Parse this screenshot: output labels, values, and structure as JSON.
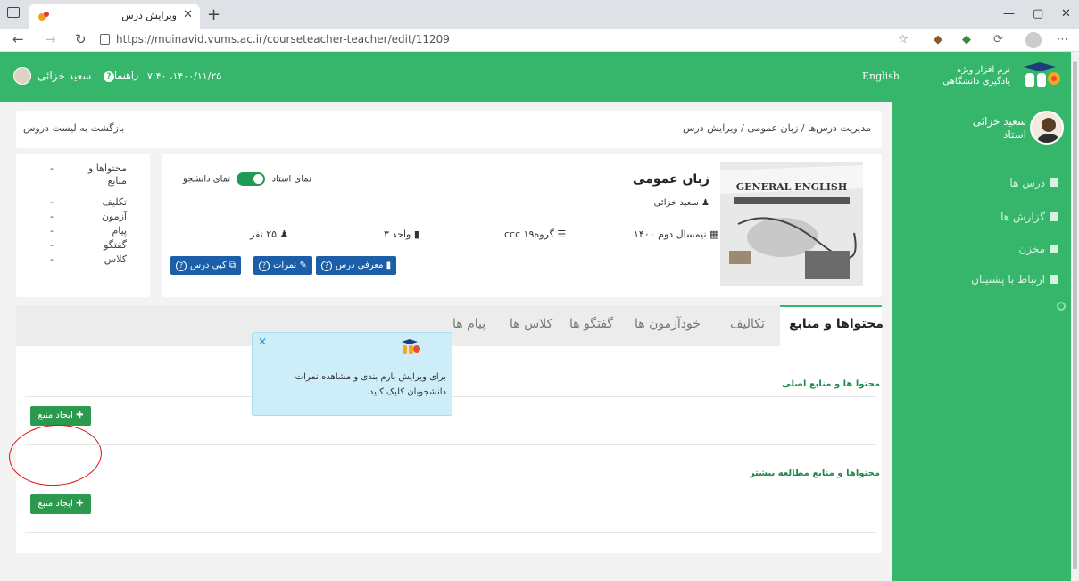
{
  "browser": {
    "tab_title": "ویرایش درس",
    "url": "https://muinavid.vums.ac.ir/courseteacher-teacher/edit/11209"
  },
  "header": {
    "brand_line1": "نرم افزار ویژه",
    "brand_line2": "یادگیری دانشگاهی",
    "language": "English",
    "user_name": "سعید خزائی",
    "help": "راهنما",
    "datetime": "۷:۴۰ ،۱۴۰۰/۱۱/۲۵"
  },
  "sidebar": {
    "user_name": "سعید خزائی",
    "user_role": "استاد",
    "items": [
      {
        "label": "درس ها",
        "icon": "book-icon"
      },
      {
        "label": "گزارش ها",
        "icon": "chart-icon"
      },
      {
        "label": "مخزن",
        "icon": "file-icon"
      },
      {
        "label": "ارتباط با پشتیبان",
        "icon": "envelope-icon"
      }
    ]
  },
  "breadcrumb": {
    "path": "مدیریت درس‌ها / زبان عمومی / ویرایش درس",
    "back": "بازگشت به لیست دروس"
  },
  "course": {
    "title": "زبان عمومی",
    "teacher": "سعید خزائی",
    "semester": "نیمسال دوم ۱۴۰۰",
    "group": "گروه۱۹ ccc",
    "units": "واحد ۳",
    "students": "۲۵ نفر",
    "view_student": "نمای دانشجو",
    "view_teacher": "نمای استاد",
    "cover_title": "GENERAL ENGLISH",
    "buttons": {
      "intro": "معرفی درس",
      "grades": "نمرات",
      "copy": "کپی درس"
    }
  },
  "summary": {
    "rows": [
      {
        "label": "محتواها و منابع",
        "value": "-"
      },
      {
        "label": "تکلیف",
        "value": "-"
      },
      {
        "label": "آزمون",
        "value": "-"
      },
      {
        "label": "پیام",
        "value": "-"
      },
      {
        "label": "گفتگو",
        "value": "-"
      },
      {
        "label": "کلاس",
        "value": "-"
      }
    ]
  },
  "tabs": [
    "محتواها و منابع",
    "تکالیف",
    "خودآزمون ها",
    "گفتگو ها",
    "کلاس ها",
    "پیام ها"
  ],
  "sections": {
    "main_title": "محتوا ها و منابع اصلی",
    "extra_title": "محتواها و منابع مطالعه بیشتر",
    "create_button": "ایجاد منبع"
  },
  "popover": {
    "text": "برای ویرایش بارم بندی و مشاهده نمرات دانشجویان کلیک کنید."
  }
}
